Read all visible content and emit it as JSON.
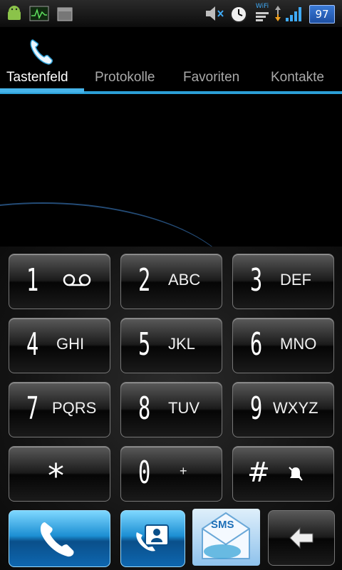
{
  "status_bar": {
    "battery_level": "97",
    "wifi_label": "WiFi",
    "icons": [
      "android-debug-icon",
      "activity-monitor-icon",
      "calendar-icon",
      "speaker-muted-icon",
      "alarm-clock-icon",
      "wifi-icon",
      "data-transfer-icon",
      "signal-bars-icon",
      "battery-icon"
    ]
  },
  "tabs": [
    {
      "label": "Tastenfeld",
      "selected": true
    },
    {
      "label": "Protokolle",
      "selected": false
    },
    {
      "label": "Favoriten",
      "selected": false
    },
    {
      "label": "Kontakte",
      "selected": false
    }
  ],
  "keypad": {
    "keys": [
      {
        "digit": "1",
        "letters": "",
        "icon": "voicemail-icon"
      },
      {
        "digit": "2",
        "letters": "ABC"
      },
      {
        "digit": "3",
        "letters": "DEF"
      },
      {
        "digit": "4",
        "letters": "GHI"
      },
      {
        "digit": "5",
        "letters": "JKL"
      },
      {
        "digit": "6",
        "letters": "MNO"
      },
      {
        "digit": "7",
        "letters": "PQRS"
      },
      {
        "digit": "8",
        "letters": "TUV"
      },
      {
        "digit": "9",
        "letters": "WXYZ"
      },
      {
        "digit": "*",
        "letters": ""
      },
      {
        "digit": "0",
        "letters": "+"
      },
      {
        "digit": "#",
        "letters": "",
        "icon": "silent-mode-icon"
      }
    ]
  },
  "bottom_actions": {
    "sms_label": "SMS"
  },
  "colors": {
    "accent": "#2c9fd6",
    "call_button": "#1c8fd3"
  }
}
